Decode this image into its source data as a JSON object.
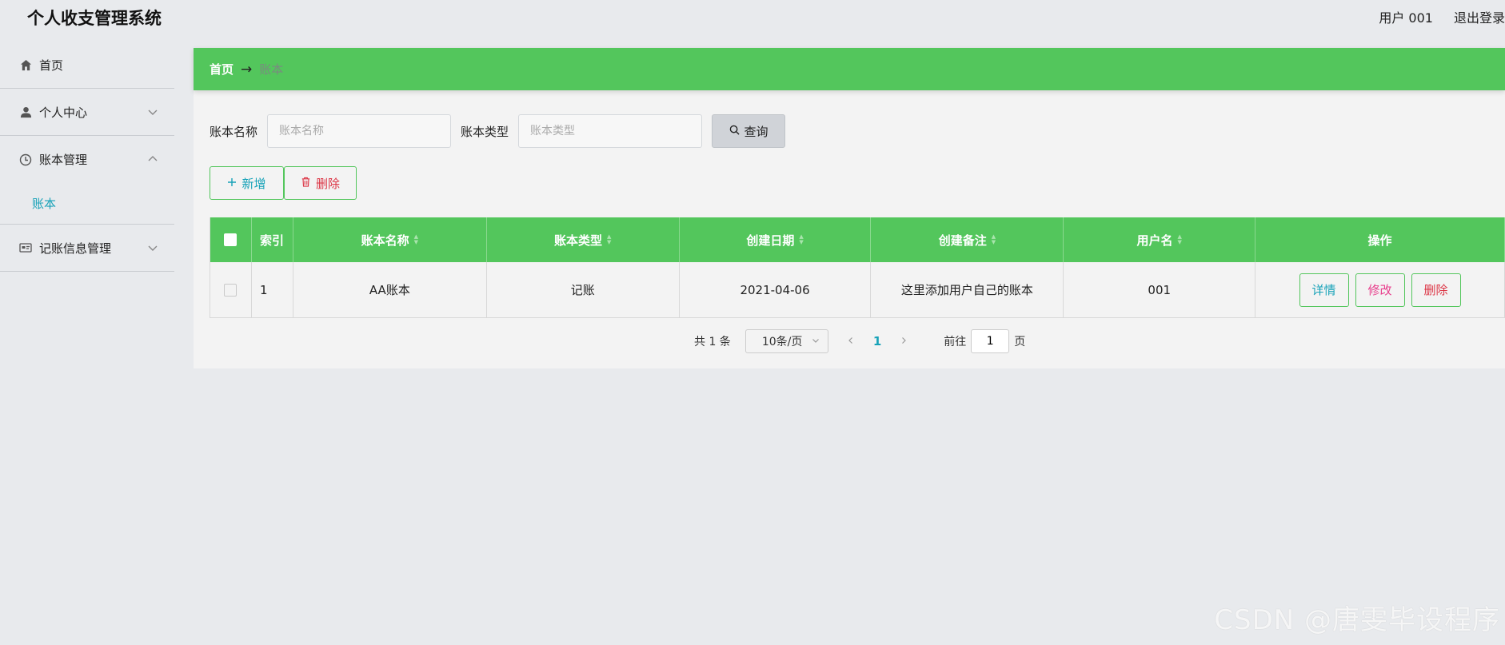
{
  "header": {
    "title": "个人收支管理系统",
    "user": "用户 001",
    "logout": "退出登录"
  },
  "sidebar": {
    "items": [
      {
        "label": "首页",
        "icon": "home-icon"
      },
      {
        "label": "个人中心",
        "icon": "user-icon"
      },
      {
        "label": "账本管理",
        "icon": "clock-icon",
        "sub": "账本"
      },
      {
        "label": "记账信息管理",
        "icon": "card-icon"
      }
    ]
  },
  "breadcrumb": {
    "home": "首页",
    "separator": "→",
    "current": "账本"
  },
  "search": {
    "name_label": "账本名称",
    "name_placeholder": "账本名称",
    "type_label": "账本类型",
    "type_placeholder": "账本类型",
    "query_label": "查询"
  },
  "actions": {
    "add_label": "新增",
    "delete_label": "删除"
  },
  "table": {
    "headers": [
      "索引",
      "账本名称",
      "账本类型",
      "创建日期",
      "创建备注",
      "用户名",
      "操作"
    ],
    "rows": [
      {
        "index": "1",
        "name": "AA账本",
        "type": "记账",
        "date": "2021-04-06",
        "note": "这里添加用户自己的账本",
        "user": "001"
      }
    ],
    "ops": {
      "detail": "详情",
      "edit": "修改",
      "delete": "删除"
    }
  },
  "pagination": {
    "total": "共 1 条",
    "size": "10条/页",
    "current": "1",
    "goto": "前往",
    "goto_value": "1",
    "page_suffix": "页"
  },
  "watermark": "CSDN @唐雯毕设程序",
  "colors": {
    "accent": "#53c65c",
    "link": "#17a2b8",
    "danger": "#dc3545",
    "edit": "#e83e8c"
  }
}
